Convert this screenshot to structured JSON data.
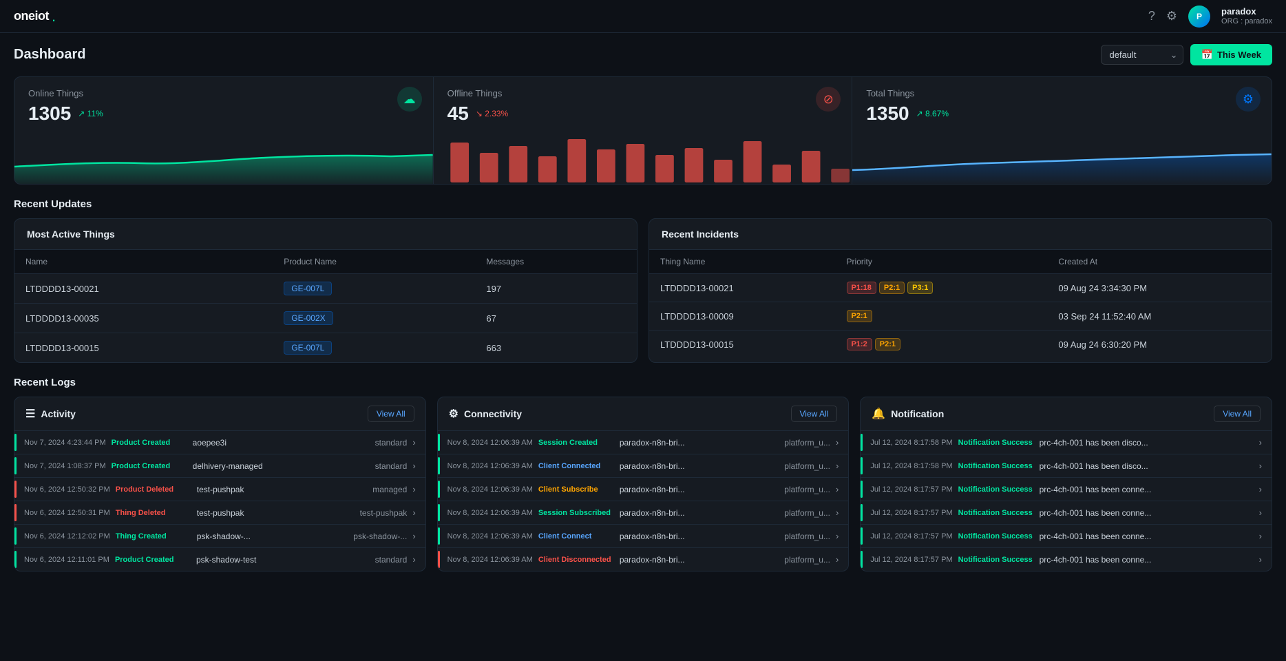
{
  "header": {
    "logo": "oneiot",
    "logo_dot": ".",
    "icons": [
      "question-circle",
      "settings"
    ],
    "user": {
      "name": "paradox",
      "org_label": "ORG : paradox",
      "initials": "P"
    }
  },
  "dashboard": {
    "title": "Dashboard",
    "dropdown_value": "default",
    "this_week_label": "This Week"
  },
  "stats": [
    {
      "label": "Online Things",
      "value": "1305",
      "change": "↗ 11%",
      "change_type": "up",
      "icon": "☁",
      "icon_type": "online"
    },
    {
      "label": "Offline Things",
      "value": "45",
      "change": "↘ 2.33%",
      "change_type": "down",
      "icon": "⊘",
      "icon_type": "offline"
    },
    {
      "label": "Total Things",
      "value": "1350",
      "change": "↗ 8.67%",
      "change_type": "up",
      "icon": "⚙",
      "icon_type": "total"
    }
  ],
  "recent_updates_title": "Recent Updates",
  "most_active": {
    "title": "Most Active Things",
    "columns": [
      "Name",
      "Product Name",
      "Messages"
    ],
    "rows": [
      {
        "name": "LTDDDD13-00021",
        "product": "GE-007L",
        "messages": "197"
      },
      {
        "name": "LTDDDD13-00035",
        "product": "GE-002X",
        "messages": "67"
      },
      {
        "name": "LTDDDD13-00015",
        "product": "GE-007L",
        "messages": "663"
      }
    ]
  },
  "recent_incidents": {
    "title": "Recent Incidents",
    "columns": [
      "Thing Name",
      "Priority",
      "Created At"
    ],
    "rows": [
      {
        "name": "LTDDDD13-00021",
        "priorities": [
          {
            "label": "P1:18",
            "type": "p1"
          },
          {
            "label": "P2:1",
            "type": "p2"
          },
          {
            "label": "P3:1",
            "type": "p3"
          }
        ],
        "created_at": "09 Aug 24 3:34:30 PM"
      },
      {
        "name": "LTDDDD13-00009",
        "priorities": [
          {
            "label": "P2:1",
            "type": "p2"
          }
        ],
        "created_at": "03 Sep 24 11:52:40 AM"
      },
      {
        "name": "LTDDDD13-00015",
        "priorities": [
          {
            "label": "P1:2",
            "type": "p1"
          },
          {
            "label": "P2:1",
            "type": "p2"
          }
        ],
        "created_at": "09 Aug 24 6:30:20 PM"
      }
    ]
  },
  "recent_logs_title": "Recent Logs",
  "logs": {
    "activity": {
      "title": "Activity",
      "icon": "☰",
      "view_all": "View All",
      "rows": [
        {
          "time": "Nov 7, 2024 4:23:44 PM",
          "event": "Product Created",
          "event_type": "created",
          "name": "aoepee3i",
          "extra": "standard",
          "bar": "green"
        },
        {
          "time": "Nov 7, 2024 1:08:37 PM",
          "event": "Product Created",
          "event_type": "created",
          "name": "delhivery-managed",
          "extra": "standard",
          "bar": "green"
        },
        {
          "time": "Nov 6, 2024 12:50:32 PM",
          "event": "Product Deleted",
          "event_type": "deleted",
          "name": "test-pushpak",
          "extra": "managed",
          "bar": "red"
        },
        {
          "time": "Nov 6, 2024 12:50:31 PM",
          "event": "Thing Deleted",
          "event_type": "thing-deleted",
          "name": "test-pushpak",
          "extra": "test-pushpak",
          "bar": "red"
        },
        {
          "time": "Nov 6, 2024 12:12:02 PM",
          "event": "Thing Created",
          "event_type": "thing-created",
          "name": "psk-shadow-...",
          "extra": "psk-shadow-...",
          "bar": "green"
        },
        {
          "time": "Nov 6, 2024 12:11:01 PM",
          "event": "Product Created",
          "event_type": "created",
          "name": "psk-shadow-test",
          "extra": "standard",
          "bar": "green"
        }
      ]
    },
    "connectivity": {
      "title": "Connectivity",
      "icon": "⚙",
      "view_all": "View All",
      "rows": [
        {
          "time": "Nov 8, 2024 12:06:39 AM",
          "event": "Session Created",
          "event_type": "session-created",
          "name": "paradox-n8n-bri...",
          "extra": "platform_u...",
          "bar": "green"
        },
        {
          "time": "Nov 8, 2024 12:06:39 AM",
          "event": "Client Connected",
          "event_type": "client-connected",
          "name": "paradox-n8n-bri...",
          "extra": "platform_u...",
          "bar": "green"
        },
        {
          "time": "Nov 8, 2024 12:06:39 AM",
          "event": "Client Subscribe",
          "event_type": "client-subscribe",
          "name": "paradox-n8n-bri...",
          "extra": "platform_u...",
          "bar": "green"
        },
        {
          "time": "Nov 8, 2024 12:06:39 AM",
          "event": "Session Subscribed",
          "event_type": "session-subscribed",
          "name": "paradox-n8n-bri...",
          "extra": "platform_u...",
          "bar": "green"
        },
        {
          "time": "Nov 8, 2024 12:06:39 AM",
          "event": "Client Connect",
          "event_type": "client-connect",
          "name": "paradox-n8n-bri...",
          "extra": "platform_u...",
          "bar": "green"
        },
        {
          "time": "Nov 8, 2024 12:06:39 AM",
          "event": "Client Disconnected",
          "event_type": "client-disconnected",
          "name": "paradox-n8n-bri...",
          "extra": "platform_u...",
          "bar": "red"
        }
      ]
    },
    "notification": {
      "title": "Notification",
      "icon": "🔔",
      "view_all": "View All",
      "rows": [
        {
          "time": "Jul 12, 2024 8:17:58 PM",
          "event": "Notification Success",
          "event_type": "notification-success",
          "message": "prc-4ch-001 has been disco...",
          "bar": "green"
        },
        {
          "time": "Jul 12, 2024 8:17:58 PM",
          "event": "Notification Success",
          "event_type": "notification-success",
          "message": "prc-4ch-001 has been disco...",
          "bar": "green"
        },
        {
          "time": "Jul 12, 2024 8:17:57 PM",
          "event": "Notification Success",
          "event_type": "notification-success",
          "message": "prc-4ch-001 has been conne...",
          "bar": "green"
        },
        {
          "time": "Jul 12, 2024 8:17:57 PM",
          "event": "Notification Success",
          "event_type": "notification-success",
          "message": "prc-4ch-001 has been conne...",
          "bar": "green"
        },
        {
          "time": "Jul 12, 2024 8:17:57 PM",
          "event": "Notification Success",
          "event_type": "notification-success",
          "message": "prc-4ch-001 has been conne...",
          "bar": "green"
        },
        {
          "time": "Jul 12, 2024 8:17:57 PM",
          "event": "Notification Success",
          "event_type": "notification-success",
          "message": "prc-4ch-001 has been conne...",
          "bar": "green"
        }
      ]
    }
  }
}
